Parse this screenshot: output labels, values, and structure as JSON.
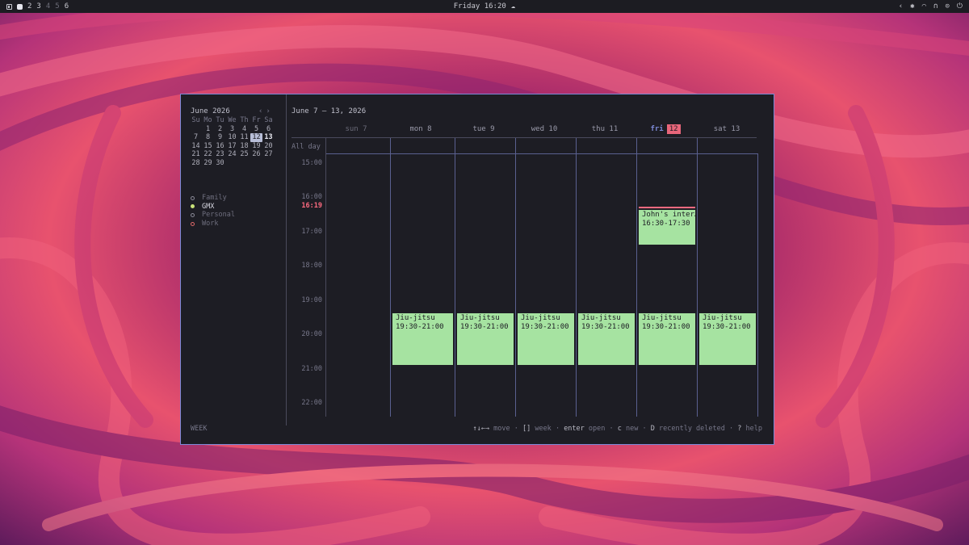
{
  "topbar": {
    "workspaces": [
      "2",
      "3",
      "4",
      "5",
      "6"
    ],
    "clock": "Friday 16:20",
    "weather_icon": "cloud-icon",
    "tray_icons": [
      "chevron-left-icon",
      "bluetooth-icon",
      "wifi-icon",
      "headphones-icon",
      "settings-icon",
      "power-icon"
    ]
  },
  "sidebar": {
    "month_title": "June 2026",
    "nav_prev": "‹",
    "nav_next": "›",
    "weekday_headers": [
      "Su",
      "Mo",
      "Tu",
      "We",
      "Th",
      "Fr",
      "Sa"
    ],
    "weeks": [
      [
        "",
        "1",
        "2",
        "3",
        "4",
        "5",
        "6"
      ],
      [
        "7",
        "8",
        "9",
        "10",
        "11",
        "12",
        "13"
      ],
      [
        "14",
        "15",
        "16",
        "17",
        "18",
        "19",
        "20"
      ],
      [
        "21",
        "22",
        "23",
        "24",
        "25",
        "26",
        "27"
      ],
      [
        "28",
        "29",
        "30",
        "",
        "",
        "",
        ""
      ]
    ],
    "today": "12",
    "calendars": [
      {
        "name": "Family",
        "enabled": false
      },
      {
        "name": "GMX",
        "enabled": true
      },
      {
        "name": "Personal",
        "enabled": false
      },
      {
        "name": "Work",
        "enabled": false
      }
    ]
  },
  "main": {
    "range_title": "June 7 – 13, 2026",
    "days": [
      {
        "label": "sun 7"
      },
      {
        "label": "mon 8"
      },
      {
        "label": "tue 9"
      },
      {
        "label": "wed 10"
      },
      {
        "label": "thu 11"
      },
      {
        "label": "fri",
        "badge": "12"
      },
      {
        "label": "sat 13"
      }
    ],
    "allday_label": "All day",
    "hours": [
      "15:00",
      "16:00",
      "17:00",
      "18:00",
      "19:00",
      "20:00",
      "21:00",
      "22:00"
    ],
    "now_label": "16:19",
    "events": {
      "john": {
        "title": "John's inter…",
        "time": "16:30-17:30"
      },
      "jj_title": "Jiu-jitsu",
      "jj_time": "19:30-21:00"
    }
  },
  "footer": {
    "mode": "WEEK",
    "hint_move_key": "↑↓←→",
    "hint_move": "move",
    "hint_week_key": "[]",
    "hint_week": "week",
    "hint_open_key": "enter",
    "hint_open": "open",
    "hint_new_key": "c",
    "hint_new": "new",
    "hint_deleted_key": "D",
    "hint_deleted": "recently deleted",
    "hint_help_key": "?",
    "hint_help": "help",
    "sep": "·"
  },
  "colors": {
    "accent": "#7d8ad8",
    "event_green": "#a6e3a1",
    "now_red": "#ff6b81",
    "today_badge": "#e8667a",
    "gmx_dot": "#c9e27a"
  }
}
